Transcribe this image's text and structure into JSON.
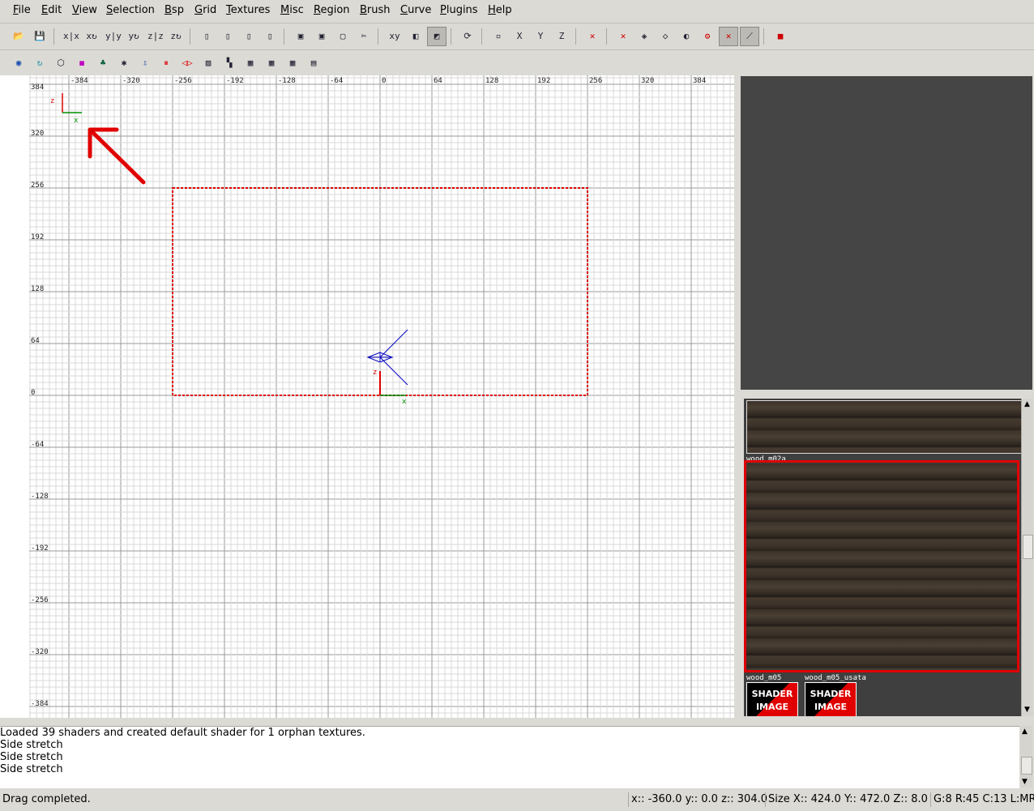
{
  "menu": [
    {
      "key": "F",
      "rest": "ile"
    },
    {
      "key": "E",
      "rest": "dit"
    },
    {
      "key": "V",
      "rest": "iew"
    },
    {
      "key": "S",
      "rest": "election"
    },
    {
      "key": "B",
      "rest": "sp"
    },
    {
      "key": "G",
      "rest": "rid"
    },
    {
      "key": "T",
      "rest": "extures"
    },
    {
      "key": "M",
      "rest": "isc"
    },
    {
      "key": "R",
      "rest": "egion"
    },
    {
      "key": "B",
      "rest": "rush"
    },
    {
      "key": "C",
      "rest": "urve"
    },
    {
      "key": "P",
      "rest": "lugins"
    },
    {
      "key": "H",
      "rest": "elp"
    }
  ],
  "toolbar1": [
    {
      "icon": "open-folder-icon",
      "glyph": "📂"
    },
    {
      "icon": "save-icon",
      "glyph": "💾"
    },
    {
      "icon": "flip-x-icon",
      "glyph": "x|x"
    },
    {
      "icon": "rotate-x-icon",
      "glyph": "x↻"
    },
    {
      "icon": "flip-y-icon",
      "glyph": "y|y"
    },
    {
      "icon": "rotate-y-icon",
      "glyph": "y↻"
    },
    {
      "icon": "flip-z-icon",
      "glyph": "z|z"
    },
    {
      "icon": "rotate-z-icon",
      "glyph": "z↻"
    },
    {
      "icon": "select-complete-tall-icon",
      "glyph": "▯"
    },
    {
      "icon": "select-touching-icon",
      "glyph": "▯"
    },
    {
      "icon": "select-partial-tall-icon",
      "glyph": "▯"
    },
    {
      "icon": "select-inside-icon",
      "glyph": "▯"
    },
    {
      "icon": "csg-subtract-icon",
      "glyph": "▣"
    },
    {
      "icon": "csg-merge-icon",
      "glyph": "▣"
    },
    {
      "icon": "make-hollow-icon",
      "glyph": "▢"
    },
    {
      "icon": "clipper-icon",
      "glyph": "✂"
    },
    {
      "icon": "change-views-icon",
      "glyph": "xy"
    },
    {
      "icon": "texture-view-icon",
      "glyph": "◧"
    },
    {
      "icon": "camera-view-icon",
      "glyph": "◩"
    },
    {
      "icon": "cubic-clip-icon",
      "glyph": "⟳"
    },
    {
      "icon": "view-xy-icon",
      "glyph": "▫"
    },
    {
      "icon": "view-x-icon",
      "glyph": "X"
    },
    {
      "icon": "view-y-icon",
      "glyph": "Y"
    },
    {
      "icon": "view-z-icon",
      "glyph": "Z"
    },
    {
      "icon": "texture-lock-icon",
      "glyph": "✕"
    },
    {
      "icon": "cube-clip-icon",
      "glyph": "✕"
    },
    {
      "icon": "texture-rotate-lock-icon",
      "glyph": "◈"
    },
    {
      "icon": "patch-icon",
      "glyph": "◇"
    },
    {
      "icon": "bend-icon",
      "glyph": "◐"
    },
    {
      "icon": "patch-drill-icon",
      "glyph": "⚙"
    },
    {
      "icon": "vertex-mode-icon",
      "glyph": "✕"
    },
    {
      "icon": "edge-mode-icon",
      "glyph": "⟋"
    },
    {
      "icon": "plugin-icon",
      "glyph": "■"
    }
  ],
  "toolbar2": [
    {
      "icon": "plugin-prefab-icon",
      "glyph": "◉"
    },
    {
      "icon": "plugin-refresh-icon",
      "glyph": "↻"
    },
    {
      "icon": "plugin-hexagon-icon",
      "glyph": "⬡"
    },
    {
      "icon": "plugin-shader-icon",
      "glyph": "◼"
    },
    {
      "icon": "plugin-tree-icon",
      "glyph": "♣"
    },
    {
      "icon": "plugin-bobtoolz-icon",
      "glyph": "✱"
    },
    {
      "icon": "plugin-drop-icon",
      "glyph": "⇩"
    },
    {
      "icon": "plugin-split-red-icon",
      "glyph": "⏸"
    },
    {
      "icon": "plugin-merge-red-icon",
      "glyph": "◁▷"
    },
    {
      "icon": "plugin-caulk-icon",
      "glyph": "▨"
    },
    {
      "icon": "plugin-terrain-icon",
      "glyph": "▚"
    },
    {
      "icon": "plugin-grid1-icon",
      "glyph": "▦"
    },
    {
      "icon": "plugin-grid2-icon",
      "glyph": "▦"
    },
    {
      "icon": "plugin-grid3-icon",
      "glyph": "▦"
    },
    {
      "icon": "plugin-grid4-icon",
      "glyph": "▤"
    }
  ],
  "grid": {
    "top_labels": [
      "-384",
      "-320",
      "-256",
      "-192",
      "-128",
      "-64",
      "0",
      "64",
      "128",
      "192",
      "256",
      "320",
      "384"
    ],
    "left_labels": [
      "384",
      "320",
      "256",
      "192",
      "128",
      "64",
      "0",
      "-64",
      "-128",
      "-192",
      "-256",
      "-320",
      "-384"
    ],
    "axis_v_label": "z",
    "axis_h_label": "x",
    "selection_color": "#e00000",
    "axis_z_color": "#e00000",
    "axis_x_color": "#009000",
    "camera_color": "#0000c0"
  },
  "left_ruler": [
    "384",
    "320",
    "256",
    "192",
    "128",
    "64",
    "0",
    "-64",
    "-128",
    "-192",
    "-256",
    "-320"
  ],
  "texture_browser": {
    "items": [
      {
        "label": "wood_m02a"
      },
      {
        "label": "wood_m05"
      },
      {
        "label": "wood_m05_usata"
      }
    ],
    "shader_text": [
      "SHADER",
      "IMAGE"
    ],
    "selected_color": "#e00000"
  },
  "console": [
    "Loaded 39 shaders and created default shader for 1 orphan textures.",
    "Side stretch",
    "Side stretch",
    "Side stretch"
  ],
  "status": {
    "message": "Drag completed.",
    "position": "x:: -360.0  y:: 0.0  z:: 304.0",
    "size": "Size X:: 424.0  Y:: 472.0  Z:: 8.0",
    "grid": "G:8 R:45 C:13 L:MR"
  }
}
